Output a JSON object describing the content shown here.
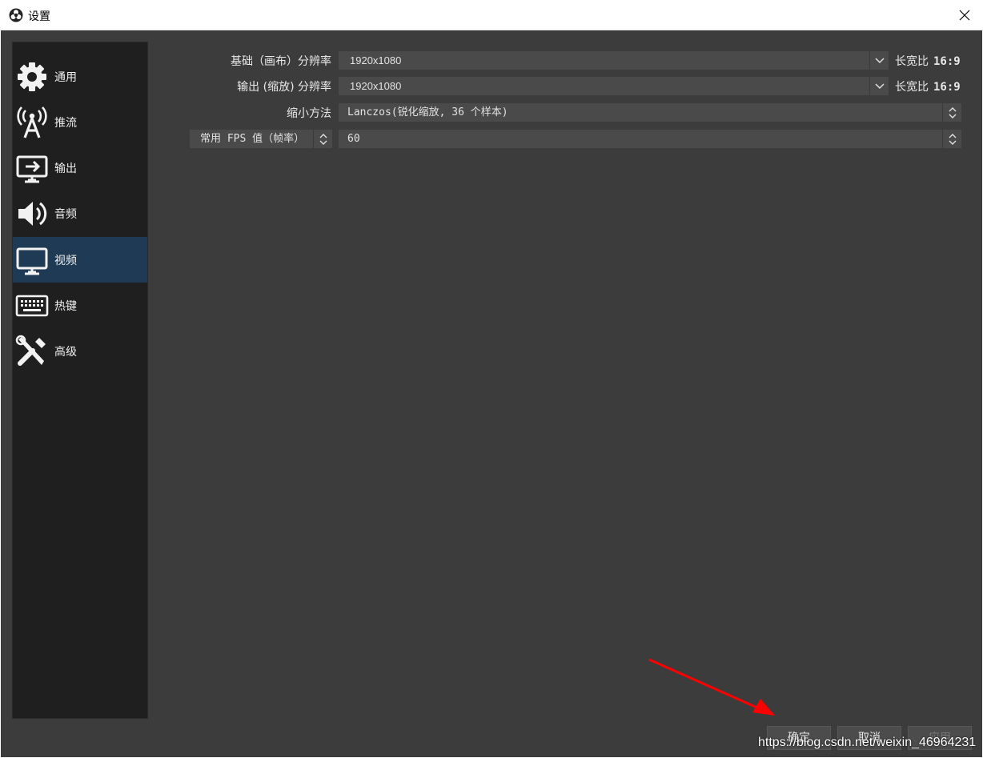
{
  "window": {
    "title": "设置",
    "close_glyph": "✕"
  },
  "sidebar": {
    "items": [
      {
        "label": "通用",
        "icon": "gear-icon",
        "active": false
      },
      {
        "label": "推流",
        "icon": "antenna-icon",
        "active": false
      },
      {
        "label": "输出",
        "icon": "monitor-arrow-icon",
        "active": false
      },
      {
        "label": "音频",
        "icon": "speaker-icon",
        "active": false
      },
      {
        "label": "视频",
        "icon": "monitor-icon",
        "active": true
      },
      {
        "label": "热键",
        "icon": "keyboard-icon",
        "active": false
      },
      {
        "label": "高级",
        "icon": "tools-icon",
        "active": false
      }
    ]
  },
  "video": {
    "base_resolution": {
      "label": "基础（画布）分辨率",
      "value": "1920x1080",
      "aspect_label": "长宽比",
      "aspect_value": "16:9"
    },
    "output_resolution": {
      "label": "输出 (缩放) 分辨率",
      "value": "1920x1080",
      "aspect_label": "长宽比",
      "aspect_value": "16:9"
    },
    "downscale_filter": {
      "label": "缩小方法",
      "value": "Lanczos(锐化缩放, 36 个样本)"
    },
    "fps": {
      "type_label": "常用 FPS 值（帧率）",
      "value": "60"
    }
  },
  "buttons": {
    "ok": "确定",
    "cancel": "取消",
    "apply": "应用"
  },
  "watermark": "https://blog.csdn.net/weixin_46964231",
  "colors": {
    "background": "#3c3c3c",
    "sidebar": "#1f1f1f",
    "active_item": "#1e3a55",
    "field": "#4a4a4a",
    "annotation_arrow": "#ff0000"
  }
}
